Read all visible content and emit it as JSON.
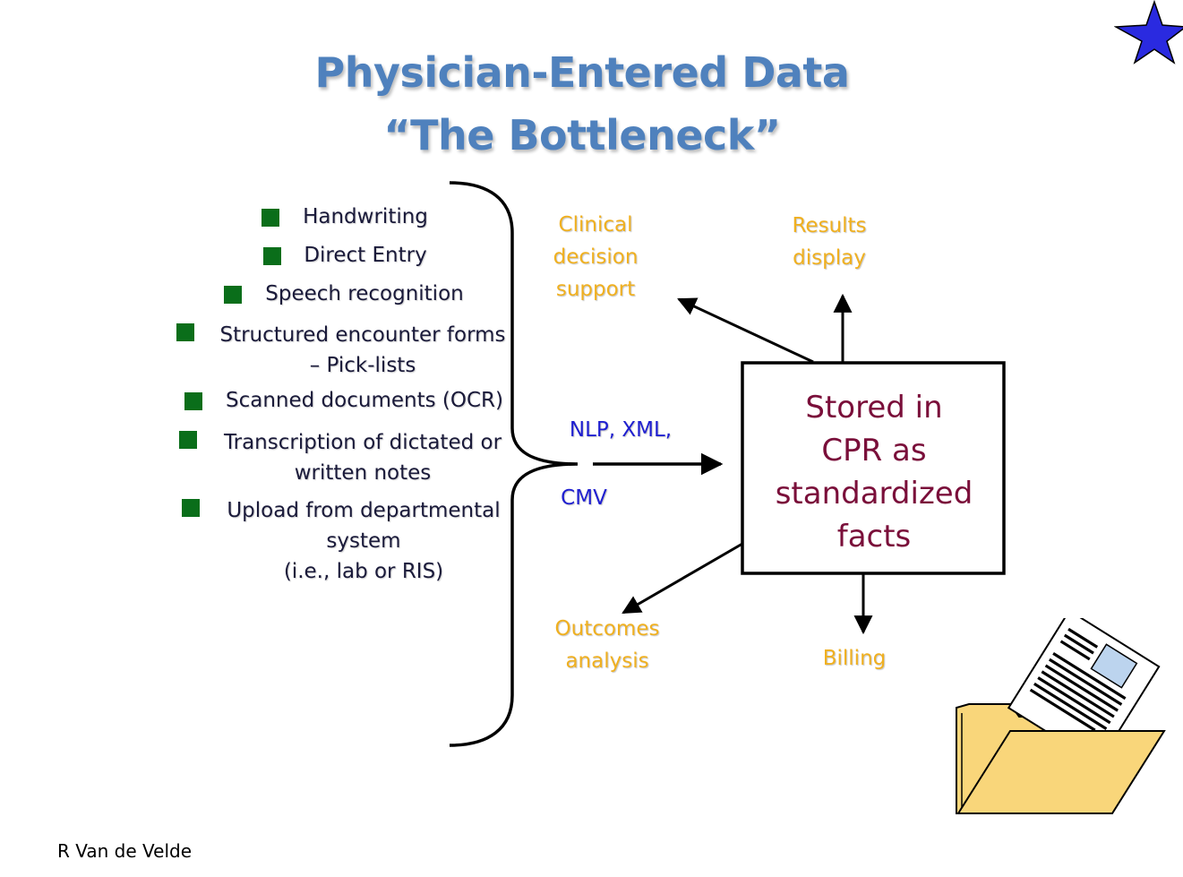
{
  "title": {
    "line1": "Physician-Entered Data",
    "line2": "“The Bottleneck”"
  },
  "bullets": [
    {
      "lines": [
        "Handwriting"
      ]
    },
    {
      "lines": [
        "Direct Entry"
      ]
    },
    {
      "lines": [
        "Speech recognition"
      ]
    },
    {
      "lines": [
        "Structured encounter forms",
        "– Pick-lists"
      ]
    },
    {
      "lines": [
        "Scanned documents (OCR)"
      ]
    },
    {
      "lines": [
        "Transcription of dictated or",
        "written notes"
      ]
    },
    {
      "lines": [
        "Upload from departmental",
        "system",
        "(i.e., lab or RIS)"
      ]
    }
  ],
  "flow": {
    "label_top": "NLP, XML,",
    "label_bottom": "CMV"
  },
  "box": {
    "lines": [
      "Stored in",
      "CPR as",
      "standardized",
      "facts"
    ]
  },
  "outputs": {
    "clinical": [
      "Clinical",
      "decision",
      "support"
    ],
    "results": [
      "Results",
      "display"
    ],
    "outcomes": [
      "Outcomes",
      "analysis"
    ],
    "billing": [
      "Billing"
    ]
  },
  "footer": "R Van de Velde",
  "icons": [
    "star-icon",
    "folder-document-icon"
  ],
  "colors": {
    "title": "#4f81bd",
    "bullet_square": "#0a6e1a",
    "bullet_text": "#1a1a3a",
    "output_label": "#f0b020",
    "flow_label": "#1f1fd0",
    "box_text": "#7a0f3a",
    "star_fill": "#2a2ae0",
    "folder_fill": "#f9d67a"
  }
}
